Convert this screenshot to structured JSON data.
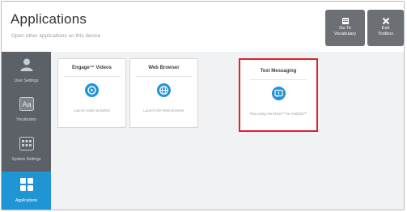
{
  "header": {
    "title": "Applications",
    "subtitle": "Open other applications on this device",
    "vocab_button": [
      "Go To",
      "Vocabulary"
    ],
    "exit_button": [
      "Exit",
      "Toolbox"
    ]
  },
  "sidebar": {
    "items": [
      {
        "label": "User Settings",
        "icon": "user-icon"
      },
      {
        "label": "Vocabulary",
        "icon": "vocabulary-icon"
      },
      {
        "label": "System Settings",
        "icon": "keyboard-grid-icon"
      },
      {
        "label": "Applications",
        "icon": "apps-grid-icon",
        "active": true
      }
    ]
  },
  "cards": [
    {
      "title": "Engage™ Videos",
      "description": "Launch video activities",
      "icon": "video-icon"
    },
    {
      "title": "Web Browser",
      "description": "Launch the Web Browser",
      "icon": "globe-icon"
    },
    {
      "title": "Text Messaging",
      "description": "Text using AeroText™ for Android™",
      "icon": "chat-icon",
      "highlighted": true
    }
  ],
  "colors": {
    "accent": "#1f95d6",
    "sidebar": "#5b6166",
    "header_button": "#6c6f73",
    "highlight_border": "#e2202b"
  }
}
